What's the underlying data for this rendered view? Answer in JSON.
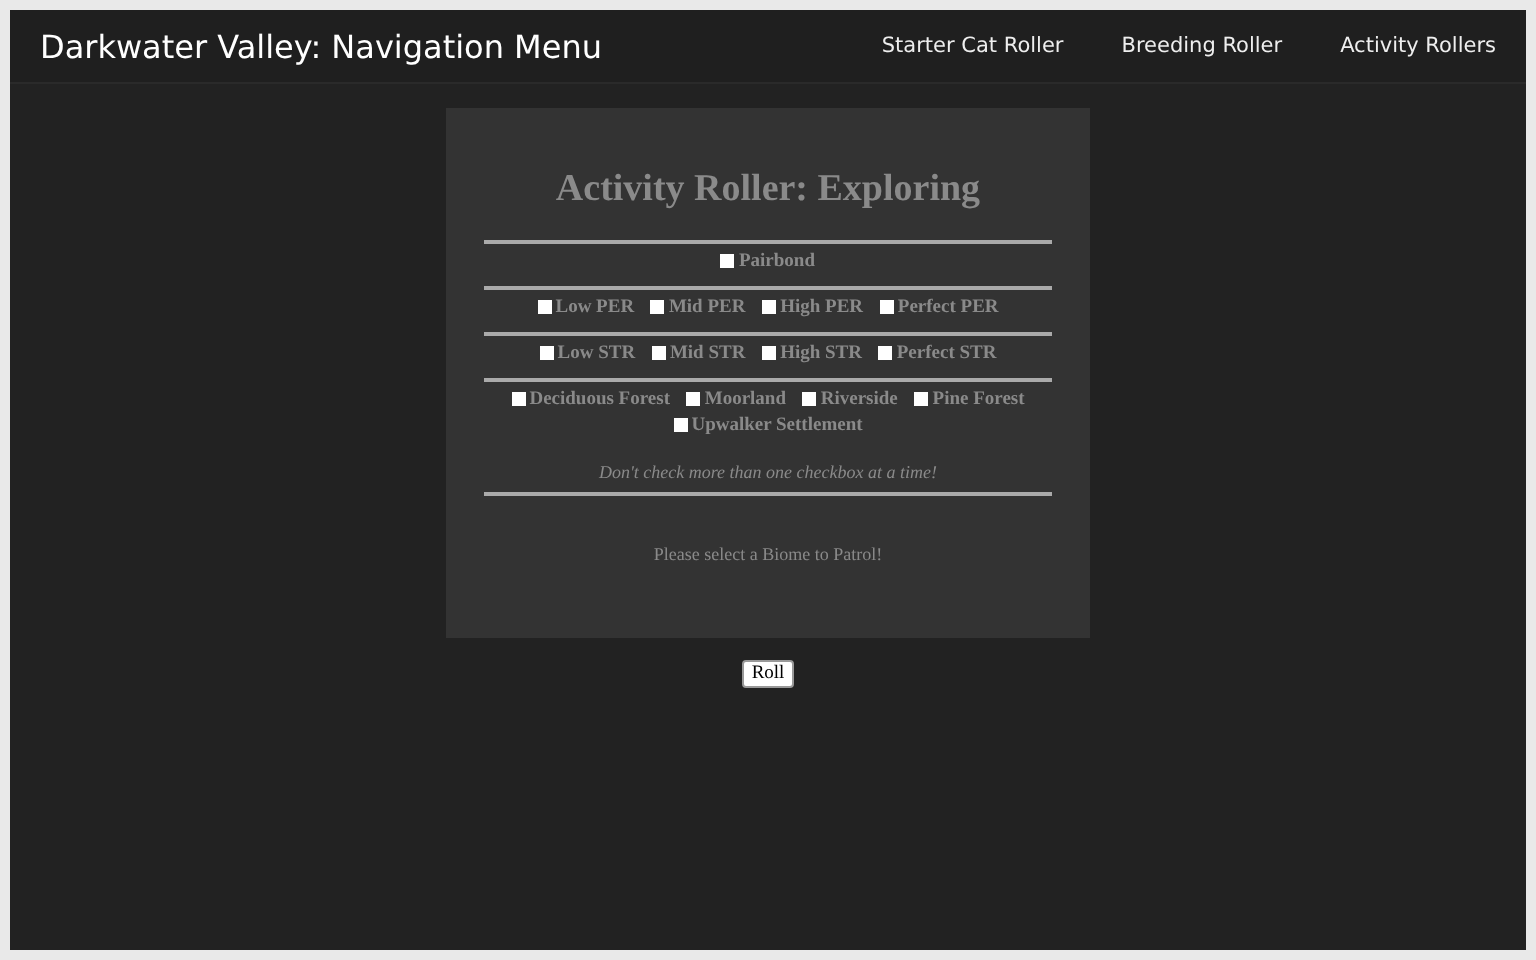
{
  "nav": {
    "title": "Darkwater Valley: Navigation Menu",
    "links": [
      {
        "label": "Starter Cat Roller"
      },
      {
        "label": "Breeding Roller"
      },
      {
        "label": "Activity Rollers"
      }
    ]
  },
  "roller": {
    "title": "Activity Roller: Exploring",
    "groups": [
      [
        {
          "label": "Pairbond",
          "checked": false
        }
      ],
      [
        {
          "label": "Low PER",
          "checked": false
        },
        {
          "label": "Mid PER",
          "checked": false
        },
        {
          "label": "High PER",
          "checked": false
        },
        {
          "label": "Perfect PER",
          "checked": false
        }
      ],
      [
        {
          "label": "Low STR",
          "checked": false
        },
        {
          "label": "Mid STR",
          "checked": false
        },
        {
          "label": "High STR",
          "checked": false
        },
        {
          "label": "Perfect STR",
          "checked": false
        }
      ],
      [
        {
          "label": "Deciduous Forest",
          "checked": false
        },
        {
          "label": "Moorland",
          "checked": false
        },
        {
          "label": "Riverside",
          "checked": false
        },
        {
          "label": "Pine Forest",
          "checked": false
        },
        {
          "label": "Upwalker Settlement",
          "checked": false
        }
      ]
    ],
    "note": "Don't check more than one checkbox at a time!",
    "result": "Please select a Biome to Patrol!"
  },
  "roll_button": "Roll"
}
